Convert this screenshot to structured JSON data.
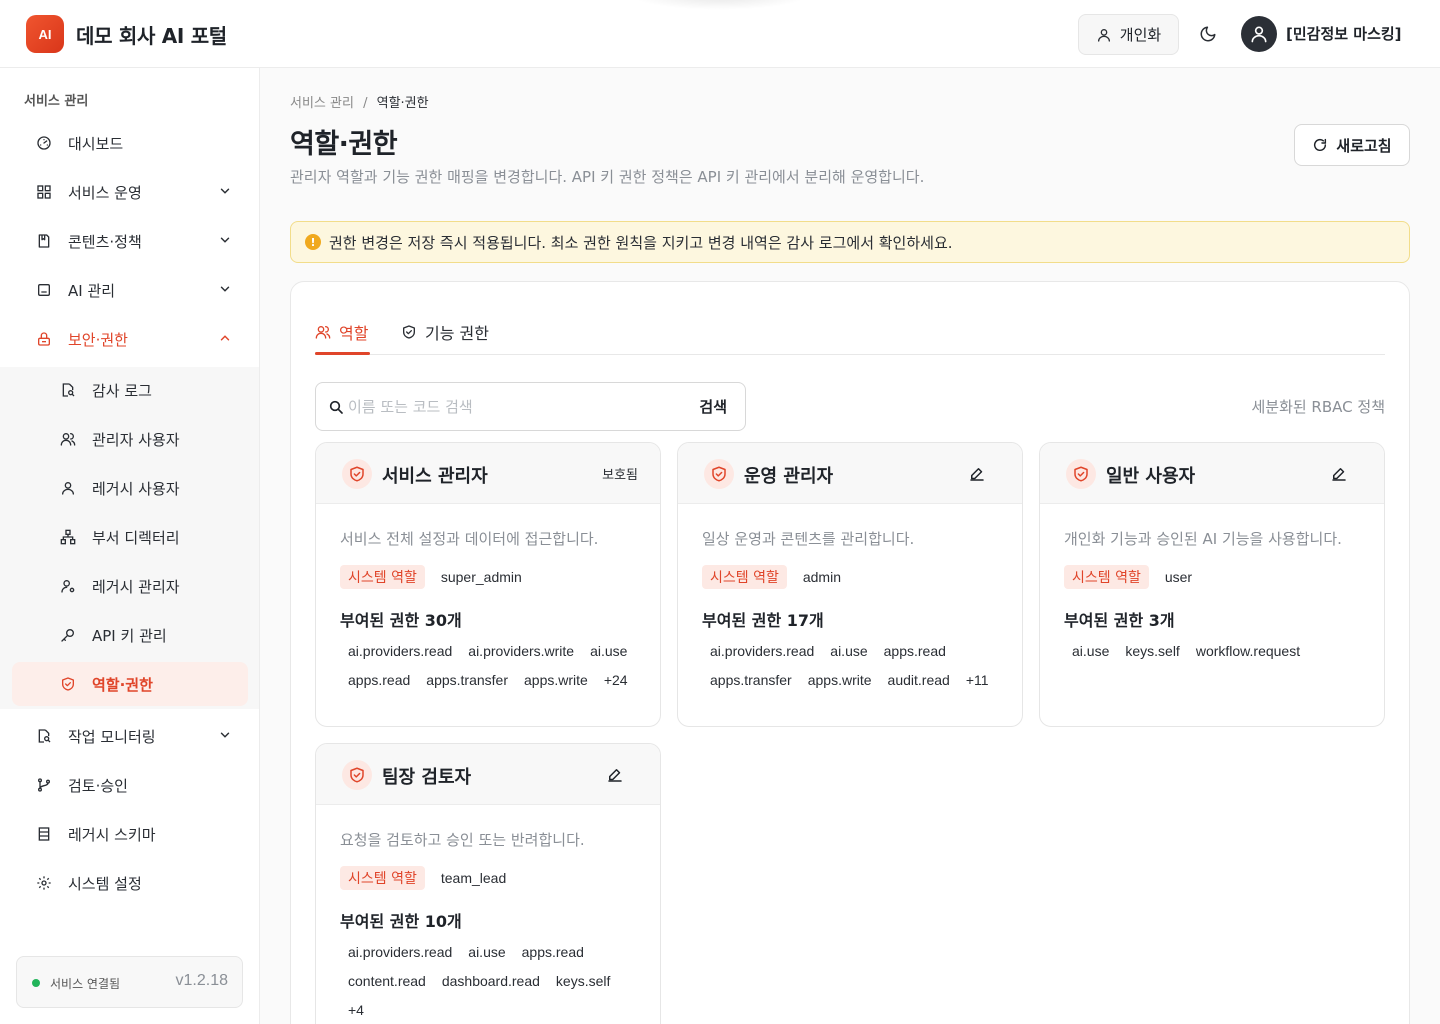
{
  "header": {
    "logo_text": "AI",
    "app_title": "데모 회사 AI 포털",
    "personal_label": "개인화",
    "user_name": "[민감정보 마스킹]"
  },
  "sidebar": {
    "section_title": "서비스 관리",
    "items": [
      {
        "label": "대시보드",
        "icon": "gauge-icon"
      },
      {
        "label": "서비스 운영",
        "icon": "grid-icon"
      },
      {
        "label": "콘텐츠·정책",
        "icon": "book-icon"
      },
      {
        "label": "AI 관리",
        "icon": "bot-icon"
      },
      {
        "label": "보안·권한",
        "icon": "lock-icon"
      }
    ],
    "sub_items": [
      {
        "label": "감사 로그",
        "icon": "file-search-icon"
      },
      {
        "label": "관리자 사용자",
        "icon": "users-icon"
      },
      {
        "label": "레거시 사용자",
        "icon": "user-icon"
      },
      {
        "label": "부서 디렉터리",
        "icon": "network-icon"
      },
      {
        "label": "레거시 관리자",
        "icon": "user-cog-icon"
      },
      {
        "label": "API 키 관리",
        "icon": "key-icon"
      },
      {
        "label": "역할·권한",
        "icon": "shield-check-icon"
      }
    ],
    "bottom_items": [
      {
        "label": "작업 모니터링",
        "icon": "file-search-icon"
      },
      {
        "label": "검토·승인",
        "icon": "git-branch-icon"
      },
      {
        "label": "레거시 스키마",
        "icon": "table-icon"
      },
      {
        "label": "시스템 설정",
        "icon": "gear-icon"
      }
    ],
    "status_text": "서비스 연결됨",
    "version": "v1.2.18"
  },
  "main": {
    "breadcrumb_parent": "서비스 관리",
    "breadcrumb_sep": "/",
    "breadcrumb_current": "역할·권한",
    "title": "역할·권한",
    "subtitle": "관리자 역할과 기능 권한 매핑을 변경합니다. API 키 권한 정책은 API 키 관리에서 분리해 운영합니다.",
    "refresh_label": "새로고침",
    "notice": "권한 변경은 저장 즉시 적용됩니다. 최소 권한 원칙을 지키고 변경 내역은 감사 로그에서 확인하세요.",
    "notice_icon": "!",
    "tabs": [
      {
        "label": "역할",
        "active": true
      },
      {
        "label": "기능 권한",
        "active": false
      }
    ],
    "search_placeholder": "이름 또는 코드 검색",
    "search_button": "검색",
    "rbac_label": "세분화된 RBAC 정책",
    "roles": [
      {
        "name": "서비스 관리자",
        "badge": "보호됨",
        "desc": "서비스 전체 설정과 데이터에 접근합니다.",
        "system_tag": "시스템 역할",
        "code": "super_admin",
        "perm_count": "부여된 권한 30개",
        "perms": [
          "ai.providers.read",
          "ai.providers.write",
          "ai.use",
          "apps.read",
          "apps.transfer",
          "apps.write",
          "+24"
        ]
      },
      {
        "name": "운영 관리자",
        "badge": "",
        "desc": "일상 운영과 콘텐츠를 관리합니다.",
        "system_tag": "시스템 역할",
        "code": "admin",
        "perm_count": "부여된 권한 17개",
        "perms": [
          "ai.providers.read",
          "ai.use",
          "apps.read",
          "apps.transfer",
          "apps.write",
          "audit.read",
          "+11"
        ]
      },
      {
        "name": "일반 사용자",
        "badge": "",
        "desc": "개인화 기능과 승인된 AI 기능을 사용합니다.",
        "system_tag": "시스템 역할",
        "code": "user",
        "perm_count": "부여된 권한 3개",
        "perms": [
          "ai.use",
          "keys.self",
          "workflow.request"
        ]
      },
      {
        "name": "팀장 검토자",
        "badge": "",
        "desc": "요청을 검토하고 승인 또는 반려합니다.",
        "system_tag": "시스템 역할",
        "code": "team_lead",
        "perm_count": "부여된 권한 10개",
        "perms": [
          "ai.providers.read",
          "ai.use",
          "apps.read",
          "content.read",
          "dashboard.read",
          "keys.self",
          "+4"
        ]
      }
    ]
  },
  "colors": {
    "accent": "#e0452a",
    "accent_soft": "#fde9e4",
    "notice_bg": "#fdf7df",
    "status_ok": "#22b45a"
  }
}
